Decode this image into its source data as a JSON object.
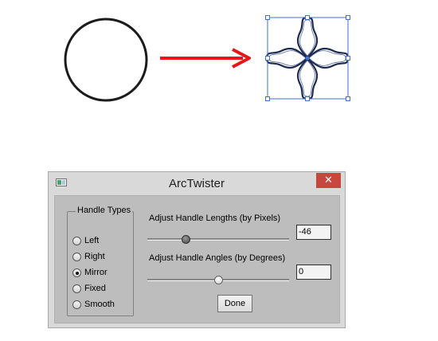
{
  "window": {
    "title": "ArcTwister",
    "close_glyph": "✕"
  },
  "handle_types": {
    "label": "Handle Types",
    "options": [
      "Left",
      "Right",
      "Mirror",
      "Fixed",
      "Smooth"
    ],
    "selected": "Mirror"
  },
  "length": {
    "label": "Adjust Handle Lengths (by Pixels)",
    "value": "-46",
    "slider_fraction": 0.27
  },
  "angle": {
    "label": "Adjust Handle Angles (by Degrees)",
    "value": "0",
    "slider_fraction": 0.5
  },
  "done_label": "Done",
  "colors": {
    "arrow": "#e8151b",
    "selection": "#3f6fd1",
    "shape_stroke": "#1e2a4f",
    "close_button": "#c7463e"
  }
}
